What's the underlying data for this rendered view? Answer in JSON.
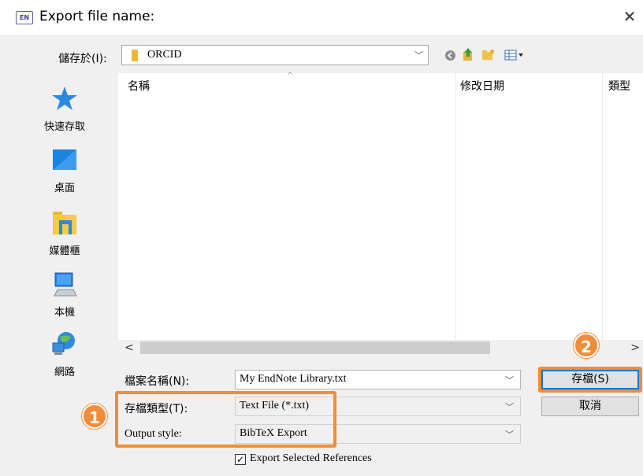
{
  "window": {
    "app_icon_text": "EN",
    "title": "Export file name:",
    "close_glyph": "✕"
  },
  "location": {
    "label": "儲存於(I):",
    "value": "ORCID"
  },
  "toolbar": {
    "icons": [
      "back-icon",
      "up-folder-icon",
      "new-folder-icon",
      "view-menu-icon"
    ]
  },
  "places": [
    {
      "label": "快速存取",
      "icon": "star-icon"
    },
    {
      "label": "桌面",
      "icon": "desktop-icon"
    },
    {
      "label": "媒體櫃",
      "icon": "library-icon"
    },
    {
      "label": "本機",
      "icon": "computer-icon"
    },
    {
      "label": "網路",
      "icon": "network-icon"
    }
  ],
  "file_list": {
    "columns": [
      "名稱",
      "修改日期",
      "類型"
    ],
    "sort_indicator": "^"
  },
  "scrollbar": {
    "left_glyph": "<",
    "right_glyph": ">"
  },
  "form": {
    "filename_label": "檔案名稱(N):",
    "filename_value": "My EndNote Library.txt",
    "filetype_label": "存檔類型(T):",
    "filetype_value": "Text File (*.txt)",
    "output_style_label": "Output style:",
    "output_style_value": "BibTeX Export",
    "export_selected_label": "Export Selected References",
    "export_selected_checked": true
  },
  "buttons": {
    "save": "存檔(S)",
    "cancel": "取消"
  },
  "annotations": {
    "step1": "1",
    "step2": "2",
    "highlight_color": "#f28c38"
  }
}
